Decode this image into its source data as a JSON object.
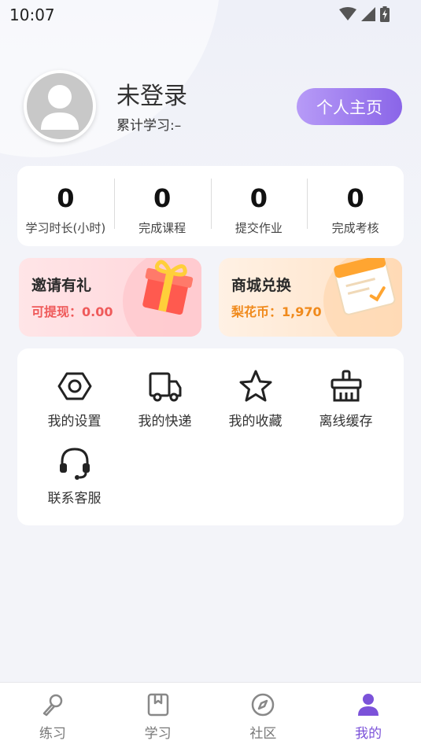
{
  "status_bar": {
    "time": "10:07"
  },
  "profile": {
    "username": "未登录",
    "study_total": "累计学习:–",
    "home_button": "个人主页"
  },
  "stats": [
    {
      "value": "0",
      "label": "学习时长(小时)"
    },
    {
      "value": "0",
      "label": "完成课程"
    },
    {
      "value": "0",
      "label": "提交作业"
    },
    {
      "value": "0",
      "label": "完成考核"
    }
  ],
  "promos": {
    "invite": {
      "title": "邀请有礼",
      "subtitle": "可提现：0.00",
      "icon": "gift-icon"
    },
    "shop": {
      "title": "商城兑换",
      "subtitle": "梨花币：1,970",
      "icon": "calendar-icon"
    }
  },
  "menu": [
    {
      "label": "我的设置",
      "icon": "settings-hexagon-icon"
    },
    {
      "label": "我的快递",
      "icon": "truck-icon"
    },
    {
      "label": "我的收藏",
      "icon": "star-icon"
    },
    {
      "label": "离线缓存",
      "icon": "broom-icon"
    },
    {
      "label": "联系客服",
      "icon": "headset-icon"
    }
  ],
  "bottom_nav": [
    {
      "label": "练习",
      "icon": "pen-icon"
    },
    {
      "label": "学习",
      "icon": "book-icon"
    },
    {
      "label": "社区",
      "icon": "compass-icon"
    },
    {
      "label": "我的",
      "icon": "person-icon",
      "active": true
    }
  ],
  "colors": {
    "accent": "#8a65e8",
    "accent_light": "#b79bf7",
    "invite_text": "#ef5a5a",
    "shop_text": "#f08a1c",
    "background": "#f3f4f9"
  }
}
